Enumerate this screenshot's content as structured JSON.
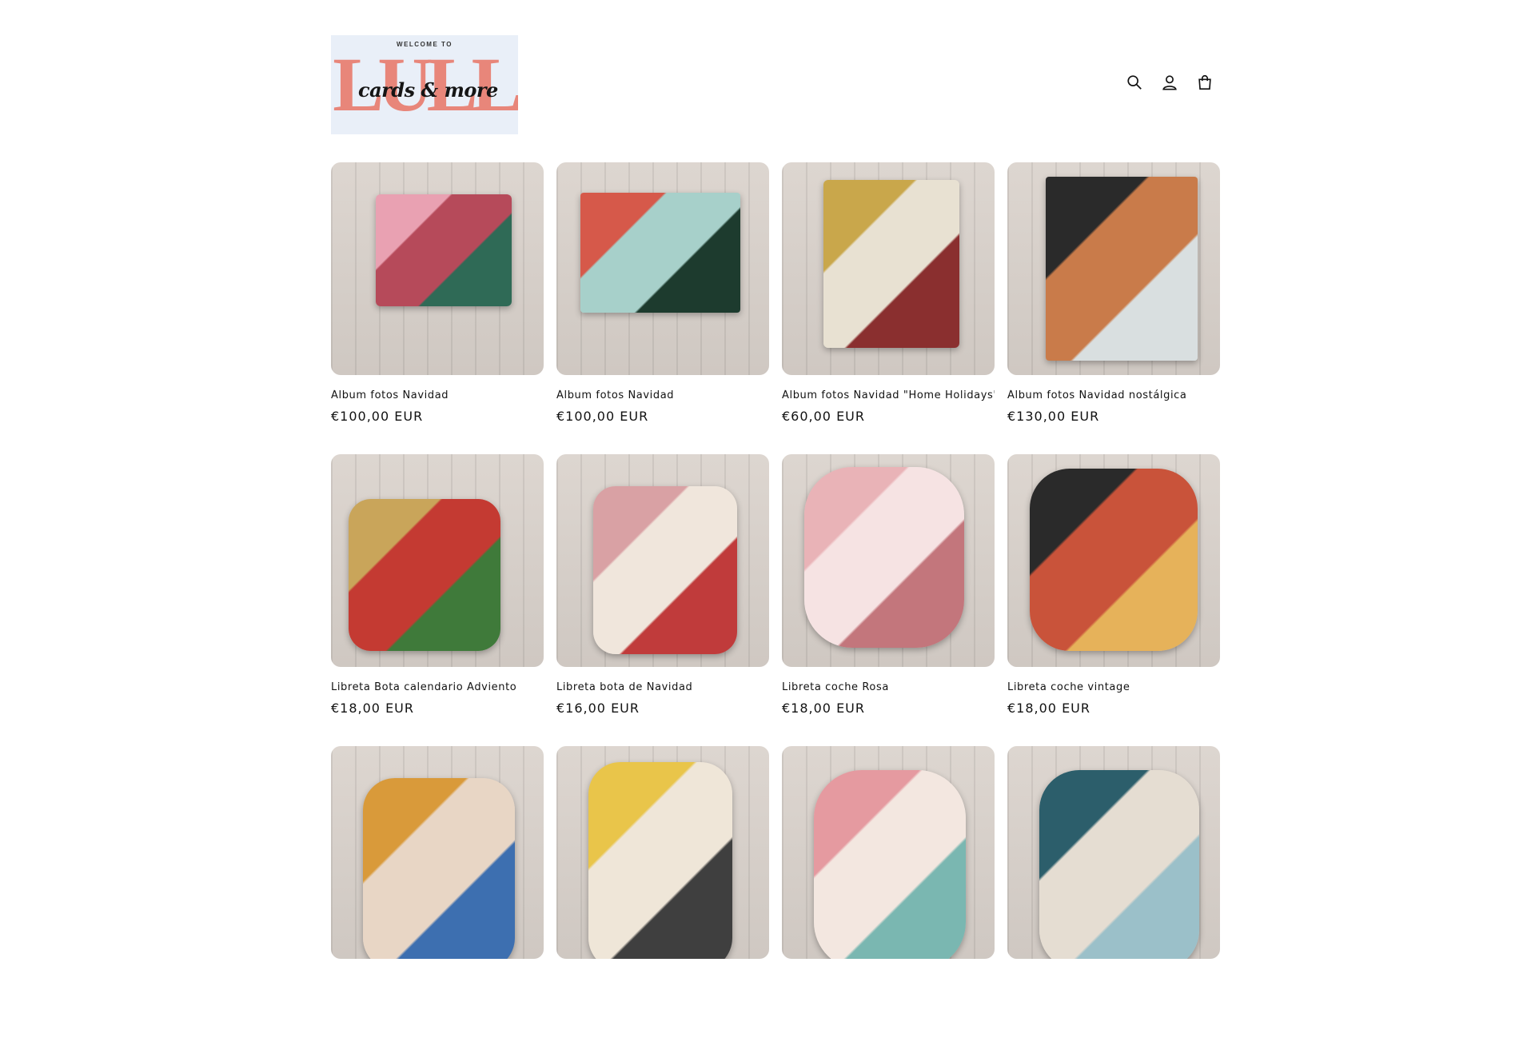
{
  "header": {
    "logo": {
      "welcome": "WELCOME TO",
      "big": "LULL",
      "script": "cards & more"
    },
    "icons": [
      "search-icon",
      "account-icon",
      "cart-icon"
    ]
  },
  "products": [
    {
      "title": "Álbum fotos Navidad",
      "price": "€100,00 EUR",
      "colors": [
        "#e9a1b2",
        "#2f6a56",
        "#b64a5a"
      ]
    },
    {
      "title": "Álbum fotos Navidad",
      "price": "€100,00 EUR",
      "colors": [
        "#d6594a",
        "#1d3b2e",
        "#a7d0ca"
      ]
    },
    {
      "title": "Álbum fotos Navidad \"Home Holidays\"",
      "price": "€60,00 EUR",
      "colors": [
        "#c9a74b",
        "#8a2f2f",
        "#e8e1d2"
      ]
    },
    {
      "title": "Álbum fotos Navidad nostálgica",
      "price": "€130,00 EUR",
      "colors": [
        "#2a2a2a",
        "#d9dfe0",
        "#c97b4a"
      ]
    },
    {
      "title": "Libreta Bota calendario Adviento",
      "price": "€18,00 EUR",
      "colors": [
        "#c9a55a",
        "#3f7a3a",
        "#c43a32"
      ]
    },
    {
      "title": "Libreta bota de Navidad",
      "price": "€16,00 EUR",
      "colors": [
        "#d9a1a4",
        "#c03b3b",
        "#f0e6dc"
      ]
    },
    {
      "title": "Libreta coche Rosa",
      "price": "€18,00 EUR",
      "colors": [
        "#e9b3b7",
        "#c3767c",
        "#f6e3e3"
      ]
    },
    {
      "title": "Libreta coche vintage",
      "price": "€18,00 EUR",
      "colors": [
        "#2a2a2a",
        "#e6b25a",
        "#c9533a"
      ]
    },
    {
      "title": "",
      "price": "",
      "colors": [
        "#d99a3a",
        "#3d6fb0",
        "#e8d6c5"
      ]
    },
    {
      "title": "",
      "price": "",
      "colors": [
        "#e9c54a",
        "#3f3f3f",
        "#efe6d8"
      ]
    },
    {
      "title": "",
      "price": "",
      "colors": [
        "#e59aa0",
        "#7ab7b1",
        "#f3e7e0"
      ]
    },
    {
      "title": "",
      "price": "",
      "colors": [
        "#2c5e6b",
        "#9bc0c9",
        "#e5ddd2"
      ]
    }
  ]
}
